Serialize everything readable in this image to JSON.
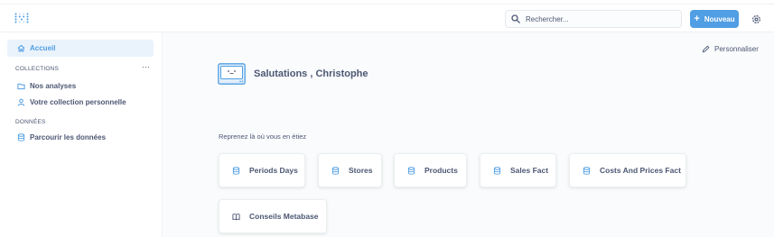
{
  "header": {
    "logo_icon": "metabase-logo-icon",
    "search_placeholder": "Rechercher...",
    "new_button_label": "Nouveau",
    "new_button_plus": "+",
    "accent_color": "#509ee3"
  },
  "sidebar": {
    "home_label": "Accueil",
    "collections_section": "COLLECTIONS",
    "collections_menu": "···",
    "collections": [
      {
        "label": "Nos analyses",
        "icon": "folder-icon"
      },
      {
        "label": "Votre collection personnelle",
        "icon": "person-icon"
      }
    ],
    "data_section": "DONNÉES",
    "browse_label": "Parcourir les données"
  },
  "main": {
    "customize_label": "Personnaliser",
    "greeting": "Salutations , Christophe",
    "resume_heading": "Reprenez là où vous en étiez",
    "cards": [
      {
        "label": "Periods Days",
        "icon": "database-table-icon"
      },
      {
        "label": "Stores",
        "icon": "database-table-icon"
      },
      {
        "label": "Products",
        "icon": "database-table-icon"
      },
      {
        "label": "Sales Fact",
        "icon": "database-table-icon"
      },
      {
        "label": "Costs And Prices Fact",
        "icon": "database-table-icon"
      },
      {
        "label": "Conseils Metabase",
        "icon": "book-icon"
      }
    ]
  }
}
